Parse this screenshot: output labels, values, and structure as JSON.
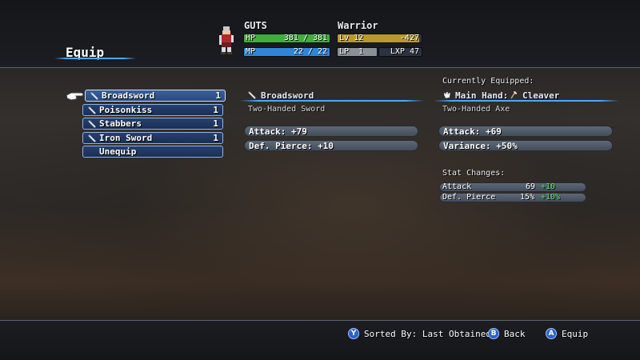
{
  "screen": {
    "title": "Equip"
  },
  "character": {
    "name": "GUTS",
    "class": "Warrior",
    "sprite_icon": "warrior-sprite-icon",
    "hp": {
      "label": "HP",
      "current": "381",
      "sep": "/",
      "max": "381",
      "fraction": 1.0,
      "color": "#3fae3a"
    },
    "mp": {
      "label": "MP",
      "current": "22",
      "sep": "/",
      "max": "22",
      "fraction": 1.0,
      "color": "#2f86d8"
    },
    "lv": {
      "label": "Lv",
      "value": "12",
      "extra": "-427",
      "fraction": 0.97,
      "color": "#b89a2a"
    },
    "lp": {
      "label": "LP",
      "value": "1",
      "fraction": 1.0,
      "color": "#8b9096"
    },
    "lxp": {
      "label": "LXP",
      "value": "47"
    }
  },
  "item_list": [
    {
      "name": "Broadsword",
      "qty": "1",
      "icon": "sword-icon",
      "selected": true
    },
    {
      "name": "Poisonkiss",
      "qty": "1",
      "icon": "sword-icon",
      "selected": false
    },
    {
      "name": "Stabbers",
      "qty": "1",
      "icon": "sword-icon",
      "selected": false
    },
    {
      "name": "Iron Sword",
      "qty": "1",
      "icon": "sword-icon",
      "selected": false
    },
    {
      "name": "Unequip",
      "qty": "",
      "icon": "",
      "selected": false
    }
  ],
  "selected_item": {
    "name": "Broadsword",
    "icon": "sword-icon",
    "type": "Two-Handed Sword",
    "stats": [
      "Attack:  +79",
      "Def. Pierce:  +10"
    ]
  },
  "current_equip": {
    "header": "Currently Equipped:",
    "slot_label": "Main Hand:",
    "slot_icon": "hand-icon",
    "item_icon": "axe-icon",
    "item_name": "Cleaver",
    "type": "Two-Handed Axe",
    "stats": [
      "Attack:  +69",
      "Variance:  +50%"
    ]
  },
  "stat_changes": {
    "header": "Stat Changes:",
    "rows": [
      {
        "label": "Attack",
        "value": "69",
        "delta": "+10"
      },
      {
        "label": "Def. Pierce",
        "value": "15%",
        "delta": "+10%"
      }
    ]
  },
  "footer": {
    "sort": {
      "button": "Y",
      "label": "Sorted By: Last Obtained"
    },
    "back": {
      "button": "B",
      "label": "Back"
    },
    "equip": {
      "button": "A",
      "label": "Equip"
    }
  },
  "colors": {
    "accent_line": "#4aa8ff",
    "delta_positive": "#5ee65e",
    "button_blue": "#2b61c9"
  }
}
